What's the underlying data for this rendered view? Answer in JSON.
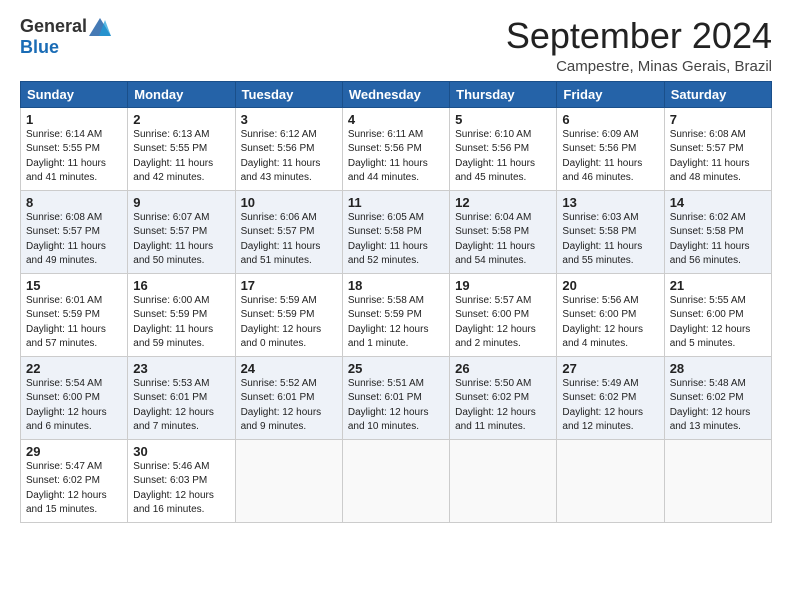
{
  "header": {
    "logo_general": "General",
    "logo_blue": "Blue",
    "month_title": "September 2024",
    "location": "Campestre, Minas Gerais, Brazil"
  },
  "weekdays": [
    "Sunday",
    "Monday",
    "Tuesday",
    "Wednesday",
    "Thursday",
    "Friday",
    "Saturday"
  ],
  "weeks": [
    [
      {
        "day": "1",
        "sunrise": "6:14 AM",
        "sunset": "5:55 PM",
        "daylight": "11 hours and 41 minutes."
      },
      {
        "day": "2",
        "sunrise": "6:13 AM",
        "sunset": "5:55 PM",
        "daylight": "11 hours and 42 minutes."
      },
      {
        "day": "3",
        "sunrise": "6:12 AM",
        "sunset": "5:56 PM",
        "daylight": "11 hours and 43 minutes."
      },
      {
        "day": "4",
        "sunrise": "6:11 AM",
        "sunset": "5:56 PM",
        "daylight": "11 hours and 44 minutes."
      },
      {
        "day": "5",
        "sunrise": "6:10 AM",
        "sunset": "5:56 PM",
        "daylight": "11 hours and 45 minutes."
      },
      {
        "day": "6",
        "sunrise": "6:09 AM",
        "sunset": "5:56 PM",
        "daylight": "11 hours and 46 minutes."
      },
      {
        "day": "7",
        "sunrise": "6:08 AM",
        "sunset": "5:57 PM",
        "daylight": "11 hours and 48 minutes."
      }
    ],
    [
      {
        "day": "8",
        "sunrise": "6:08 AM",
        "sunset": "5:57 PM",
        "daylight": "11 hours and 49 minutes."
      },
      {
        "day": "9",
        "sunrise": "6:07 AM",
        "sunset": "5:57 PM",
        "daylight": "11 hours and 50 minutes."
      },
      {
        "day": "10",
        "sunrise": "6:06 AM",
        "sunset": "5:57 PM",
        "daylight": "11 hours and 51 minutes."
      },
      {
        "day": "11",
        "sunrise": "6:05 AM",
        "sunset": "5:58 PM",
        "daylight": "11 hours and 52 minutes."
      },
      {
        "day": "12",
        "sunrise": "6:04 AM",
        "sunset": "5:58 PM",
        "daylight": "11 hours and 54 minutes."
      },
      {
        "day": "13",
        "sunrise": "6:03 AM",
        "sunset": "5:58 PM",
        "daylight": "11 hours and 55 minutes."
      },
      {
        "day": "14",
        "sunrise": "6:02 AM",
        "sunset": "5:58 PM",
        "daylight": "11 hours and 56 minutes."
      }
    ],
    [
      {
        "day": "15",
        "sunrise": "6:01 AM",
        "sunset": "5:59 PM",
        "daylight": "11 hours and 57 minutes."
      },
      {
        "day": "16",
        "sunrise": "6:00 AM",
        "sunset": "5:59 PM",
        "daylight": "11 hours and 59 minutes."
      },
      {
        "day": "17",
        "sunrise": "5:59 AM",
        "sunset": "5:59 PM",
        "daylight": "12 hours and 0 minutes."
      },
      {
        "day": "18",
        "sunrise": "5:58 AM",
        "sunset": "5:59 PM",
        "daylight": "12 hours and 1 minute."
      },
      {
        "day": "19",
        "sunrise": "5:57 AM",
        "sunset": "6:00 PM",
        "daylight": "12 hours and 2 minutes."
      },
      {
        "day": "20",
        "sunrise": "5:56 AM",
        "sunset": "6:00 PM",
        "daylight": "12 hours and 4 minutes."
      },
      {
        "day": "21",
        "sunrise": "5:55 AM",
        "sunset": "6:00 PM",
        "daylight": "12 hours and 5 minutes."
      }
    ],
    [
      {
        "day": "22",
        "sunrise": "5:54 AM",
        "sunset": "6:00 PM",
        "daylight": "12 hours and 6 minutes."
      },
      {
        "day": "23",
        "sunrise": "5:53 AM",
        "sunset": "6:01 PM",
        "daylight": "12 hours and 7 minutes."
      },
      {
        "day": "24",
        "sunrise": "5:52 AM",
        "sunset": "6:01 PM",
        "daylight": "12 hours and 9 minutes."
      },
      {
        "day": "25",
        "sunrise": "5:51 AM",
        "sunset": "6:01 PM",
        "daylight": "12 hours and 10 minutes."
      },
      {
        "day": "26",
        "sunrise": "5:50 AM",
        "sunset": "6:02 PM",
        "daylight": "12 hours and 11 minutes."
      },
      {
        "day": "27",
        "sunrise": "5:49 AM",
        "sunset": "6:02 PM",
        "daylight": "12 hours and 12 minutes."
      },
      {
        "day": "28",
        "sunrise": "5:48 AM",
        "sunset": "6:02 PM",
        "daylight": "12 hours and 13 minutes."
      }
    ],
    [
      {
        "day": "29",
        "sunrise": "5:47 AM",
        "sunset": "6:02 PM",
        "daylight": "12 hours and 15 minutes."
      },
      {
        "day": "30",
        "sunrise": "5:46 AM",
        "sunset": "6:03 PM",
        "daylight": "12 hours and 16 minutes."
      },
      null,
      null,
      null,
      null,
      null
    ]
  ]
}
